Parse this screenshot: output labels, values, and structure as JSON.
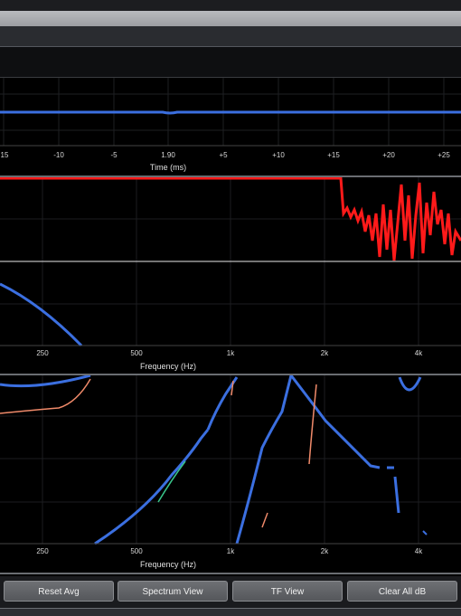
{
  "time_pane": {
    "xlabel": "Time (ms)",
    "ticks": [
      "15",
      "-10",
      "-5",
      "1.90",
      "+5",
      "+10",
      "+15",
      "+20",
      "+25"
    ]
  },
  "freq_pane_top": {
    "xlabel": "Frequency (Hz)",
    "ticks": [
      "250",
      "500",
      "1k",
      "2k",
      "4k"
    ]
  },
  "freq_pane_bottom": {
    "xlabel": "Frequency (Hz)",
    "ticks": [
      "250",
      "500",
      "1k",
      "2k",
      "4k"
    ]
  },
  "buttons": {
    "reset_avg": "Reset Avg",
    "spectrum_view": "Spectrum View",
    "tf_view": "TF View",
    "clear_all_db": "Clear All dB"
  },
  "colors": {
    "trace_blue": "#3b6fe0",
    "coherence_red": "#ff1a1a",
    "trace_salmon": "#f08a6a",
    "trace_green": "#39c48a"
  }
}
